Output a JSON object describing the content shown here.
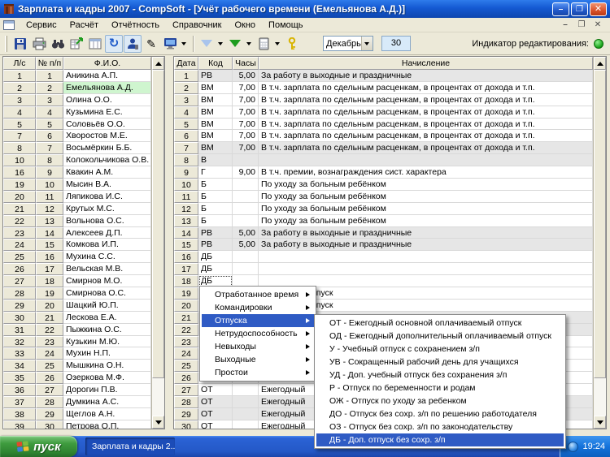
{
  "window": {
    "title": "Зарплата и кадры 2007 - CompSoft - [Учёт рабочего времени (Емельянова А.Д.)]"
  },
  "menubar": {
    "items": [
      "Сервис",
      "Расчёт",
      "Отчётность",
      "Справочник",
      "Окно",
      "Помощь"
    ],
    "mdi_controls": [
      "–",
      "❐",
      "✕"
    ]
  },
  "titlebar_buttons": [
    "–",
    "❐",
    "✕"
  ],
  "toolbar": {
    "icons": [
      "save-icon",
      "print-icon",
      "search-binoculars-icon",
      "export-grid-icon",
      "table-columns-icon",
      "refresh-icon",
      "user-call-icon",
      "edit-pen-icon",
      "monitor-icon",
      "triangle-light-blue-icon",
      "triangle-green-icon",
      "calculator-icon",
      "key-icon"
    ],
    "month": "Декабрь",
    "day": "30",
    "indicator_label": "Индикатор редактирования:"
  },
  "employees": {
    "headers": [
      "Л/с",
      "№ п/п",
      "Ф.И.О."
    ],
    "selected_index": 1,
    "rows": [
      [
        "1",
        "1",
        "Аникина А.П."
      ],
      [
        "2",
        "2",
        "Емельянова А.Д."
      ],
      [
        "3",
        "3",
        "Олина О.О."
      ],
      [
        "4",
        "4",
        "Кузьмина Е.С."
      ],
      [
        "5",
        "5",
        "Соловьёв О.О."
      ],
      [
        "7",
        "6",
        "Хворостов М.Е."
      ],
      [
        "8",
        "7",
        "Восьмёркин Б.Б."
      ],
      [
        "10",
        "8",
        "Колокольчикова О.В."
      ],
      [
        "16",
        "9",
        "Квакин А.М."
      ],
      [
        "19",
        "10",
        "Мысин В.А."
      ],
      [
        "20",
        "11",
        "Ляпикова И.С."
      ],
      [
        "21",
        "12",
        "Крутых М.С."
      ],
      [
        "22",
        "13",
        "Вольнова О.С."
      ],
      [
        "23",
        "14",
        "Алексеев Д.П."
      ],
      [
        "24",
        "15",
        "Комкова И.П."
      ],
      [
        "25",
        "16",
        "Мухина С.С."
      ],
      [
        "26",
        "17",
        "Вельская М.В."
      ],
      [
        "27",
        "18",
        "Смирнов М.О."
      ],
      [
        "28",
        "19",
        "Смирнова О.С."
      ],
      [
        "29",
        "20",
        "Шацкий Ю.П."
      ],
      [
        "30",
        "21",
        "Лескова Е.А."
      ],
      [
        "31",
        "22",
        "Пыжкина О.С."
      ],
      [
        "32",
        "23",
        "Кузькин М.Ю."
      ],
      [
        "33",
        "24",
        "Мухин Н.П."
      ],
      [
        "34",
        "25",
        "Мышкина О.Н."
      ],
      [
        "35",
        "26",
        "Озеркова М.Ф."
      ],
      [
        "36",
        "27",
        "Дорогин П.В."
      ],
      [
        "37",
        "28",
        "Думкина А.С."
      ],
      [
        "38",
        "29",
        "Щеглов А.Н."
      ],
      [
        "39",
        "30",
        "Петрова О.П."
      ]
    ]
  },
  "timesheet": {
    "headers": [
      "Дата",
      "Код",
      "Часы",
      "Начисление"
    ],
    "rows": [
      {
        "date": "1",
        "code": "РВ",
        "hours": "5,00",
        "name": "За работу в выходные и праздничные",
        "weekend": true
      },
      {
        "date": "2",
        "code": "ВМ",
        "hours": "7,00",
        "name": "В т.ч. зарплата по сдельным расценкам, в процентах от дохода и т.п."
      },
      {
        "date": "3",
        "code": "ВМ",
        "hours": "7,00",
        "name": "В т.ч. зарплата по сдельным расценкам, в процентах от дохода и т.п."
      },
      {
        "date": "4",
        "code": "ВМ",
        "hours": "7,00",
        "name": "В т.ч. зарплата по сдельным расценкам, в процентах от дохода и т.п."
      },
      {
        "date": "5",
        "code": "ВМ",
        "hours": "7,00",
        "name": "В т.ч. зарплата по сдельным расценкам, в процентах от дохода и т.п."
      },
      {
        "date": "6",
        "code": "ВМ",
        "hours": "7,00",
        "name": "В т.ч. зарплата по сдельным расценкам, в процентах от дохода и т.п."
      },
      {
        "date": "7",
        "code": "ВМ",
        "hours": "7,00",
        "name": "В т.ч. зарплата по сдельным расценкам, в процентах от дохода и т.п.",
        "weekend": true
      },
      {
        "date": "8",
        "code": "В",
        "hours": "",
        "name": "",
        "weekend": true
      },
      {
        "date": "9",
        "code": "Г",
        "hours": "9,00",
        "name": "В т.ч. премии, вознаграждения сист. характера"
      },
      {
        "date": "10",
        "code": "Б",
        "hours": "",
        "name": "По уходу за больным ребёнком"
      },
      {
        "date": "11",
        "code": "Б",
        "hours": "",
        "name": "По уходу за больным ребёнком"
      },
      {
        "date": "12",
        "code": "Б",
        "hours": "",
        "name": "По уходу за больным ребёнком"
      },
      {
        "date": "13",
        "code": "Б",
        "hours": "",
        "name": "По уходу за больным ребёнком"
      },
      {
        "date": "14",
        "code": "РВ",
        "hours": "5,00",
        "name": "За работу в выходные и праздничные",
        "weekend": true
      },
      {
        "date": "15",
        "code": "РВ",
        "hours": "5,00",
        "name": "За работу в выходные и праздничные",
        "weekend": true
      },
      {
        "date": "16",
        "code": "ДБ",
        "hours": "",
        "name": ""
      },
      {
        "date": "17",
        "code": "ДБ",
        "hours": "",
        "name": ""
      },
      {
        "date": "18",
        "code": "ДБ",
        "hours": "",
        "name": "",
        "focused": true
      },
      {
        "date": "19",
        "code": "",
        "hours": "",
        "name": "тпуск",
        "fragment": true
      },
      {
        "date": "20",
        "code": "",
        "hours": "",
        "name": "тпуск",
        "fragment": true
      },
      {
        "date": "21",
        "code": "",
        "hours": "",
        "name": "",
        "weekend": true
      },
      {
        "date": "22",
        "code": "",
        "hours": "",
        "name": "",
        "weekend": true
      },
      {
        "date": "23",
        "code": "",
        "hours": "",
        "name": ""
      },
      {
        "date": "24",
        "code": "",
        "hours": "",
        "name": ""
      },
      {
        "date": "25",
        "code": "",
        "hours": "",
        "name": ""
      },
      {
        "date": "26",
        "code": "",
        "hours": "",
        "name": ""
      },
      {
        "date": "27",
        "code": "ОТ",
        "hours": "",
        "name": "Ежегодный"
      },
      {
        "date": "28",
        "code": "ОТ",
        "hours": "",
        "name": "Ежегодный",
        "weekend": true
      },
      {
        "date": "29",
        "code": "ОТ",
        "hours": "",
        "name": "Ежегодный",
        "weekend": true
      },
      {
        "date": "30",
        "code": "ОТ",
        "hours": "",
        "name": "Ежегодный"
      }
    ]
  },
  "context_menu": {
    "items": [
      {
        "label": "Отработанное время"
      },
      {
        "label": "Командировки"
      },
      {
        "label": "Отпуска",
        "selected": true
      },
      {
        "label": "Нетрудоспособность"
      },
      {
        "label": "Невыходы"
      },
      {
        "label": "Выходные"
      },
      {
        "label": "Простои"
      }
    ]
  },
  "submenu": {
    "items": [
      {
        "label": "ОТ - Ежегодный основной оплачиваемый отпуск"
      },
      {
        "label": "ОД - Ежегодный дополнительный оплачиваемый отпуск"
      },
      {
        "label": "У - Учебный отпуск с сохранением з/п"
      },
      {
        "label": "УВ - Сокращенный рабочий день для учащихся"
      },
      {
        "label": "УД - Доп. учебный отпуск без сохранения з/п"
      },
      {
        "label": "Р - Отпуск по беременности и родам"
      },
      {
        "label": "ОЖ - Отпуск по уходу за ребенком"
      },
      {
        "label": "ДО - Отпуск без сохр. з/п по решению работодателя"
      },
      {
        "label": "ОЗ - Отпуск без сохр. з/п по законодательству"
      },
      {
        "label": "ДБ - Доп. отпуск без сохр. з/п",
        "selected": true
      }
    ]
  },
  "taskbar": {
    "start_label": "пуск",
    "app_label": "Зарплата и кадры 2...",
    "time": "19:24"
  },
  "colors": {
    "selection_blue": "#2F5BC4",
    "selected_person_green": "#CFF5CF",
    "weekend_gray": "#E6E6E6",
    "indicator_green": "#17A017"
  }
}
